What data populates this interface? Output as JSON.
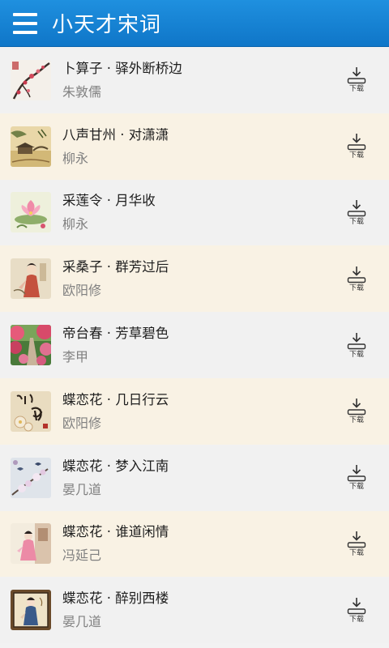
{
  "app": {
    "title": "小天才宋词"
  },
  "download_label": "下载",
  "items": [
    {
      "title": "卜算子 · 驿外断桥边",
      "author": "朱敦儒",
      "thumb": "plum-blossom-painting"
    },
    {
      "title": "八声甘州 · 对潇潇",
      "author": "柳永",
      "thumb": "landscape-pavilion-painting"
    },
    {
      "title": "采莲令 · 月华收",
      "author": "柳永",
      "thumb": "lotus-painting"
    },
    {
      "title": "采桑子 · 群芳过后",
      "author": "欧阳修",
      "thumb": "lady-portrait-painting"
    },
    {
      "title": "帝台春 · 芳草碧色",
      "author": "李甲",
      "thumb": "garden-path-photo"
    },
    {
      "title": "蝶恋花 · 几日行云",
      "author": "欧阳修",
      "thumb": "calligraphy-flower-painting"
    },
    {
      "title": "蝶恋花 · 梦入江南",
      "author": "晏几道",
      "thumb": "birds-blossom-painting"
    },
    {
      "title": "蝶恋花 · 谁道闲情",
      "author": "冯延己",
      "thumb": "lady-in-pink-painting"
    },
    {
      "title": "蝶恋花 · 醉别西楼",
      "author": "晏几道",
      "thumb": "framed-lady-painting"
    }
  ],
  "colors": {
    "appbar": "#1a86d6",
    "row_odd": "#f1f1f1",
    "row_even": "#f9f2e4"
  }
}
